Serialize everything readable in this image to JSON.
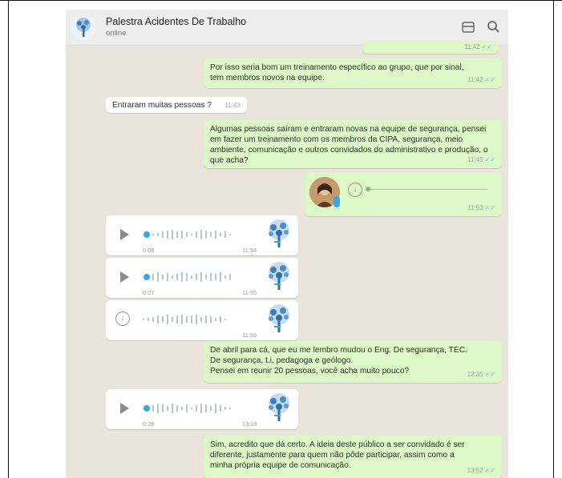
{
  "header": {
    "title": "Palestra Acidentes De Trabalho",
    "status": "online"
  },
  "messages": [
    {
      "id": "m0",
      "type": "text",
      "dir": "out",
      "text": "",
      "time": "11:42"
    },
    {
      "id": "m1",
      "type": "text",
      "dir": "out",
      "text": "Por isso seria bom um treinamento específico ao grupo, que por sinal, tem membros novos na equipe.",
      "time": "11:42"
    },
    {
      "id": "m2",
      "type": "text",
      "dir": "in",
      "text": "Entraram muitas pessoas ?",
      "time": "11:43"
    },
    {
      "id": "m3",
      "type": "text",
      "dir": "out",
      "text": "Algumas pessoas saíram e entraram novas na equipe de segurança, pensei em fazer um treinamento com os membros da CIPA, segurança, meio ambiente, comunicação e outros convidados do administrativo e produção, o que acha?",
      "time": "11:45"
    },
    {
      "id": "m4",
      "type": "audio",
      "dir": "out",
      "state": "download",
      "time": "11:53"
    },
    {
      "id": "m5",
      "type": "audio",
      "dir": "in",
      "state": "play",
      "duration": "0:08",
      "time": "11:54"
    },
    {
      "id": "m6",
      "type": "audio",
      "dir": "in",
      "state": "play",
      "duration": "0:27",
      "time": "11:55"
    },
    {
      "id": "m7",
      "type": "audio",
      "dir": "in",
      "state": "download",
      "duration": "",
      "time": "11:55"
    },
    {
      "id": "m8",
      "type": "text",
      "dir": "out",
      "text": "De abril para cá, que eu me lembro mudou o Eng. De segurança, TEC. De segurança, t.i, pedagoga e geólogo.\nPensei em reunir 20 pessoas, você acha muito pouco?",
      "time": "12:35"
    },
    {
      "id": "m9",
      "type": "audio",
      "dir": "in",
      "state": "play",
      "duration": "0:28",
      "time": "13:18"
    },
    {
      "id": "m10",
      "type": "text",
      "dir": "out",
      "text": "Sim, acredito que dá certo. A ideia deste público a ser convidado é ser diferente, justamente para quem não pôde participar, assim como a minha própria equipe de comunicação.",
      "time": "13:52"
    }
  ],
  "colors": {
    "outgoing": "#dcf8c6",
    "incoming": "#ffffff",
    "background": "#e9e4dc",
    "accent": "#35a8e0"
  },
  "icons": [
    "attach-icon",
    "search-icon",
    "play-icon",
    "download-icon",
    "tree-avatar-icon",
    "contact-avatar"
  ]
}
